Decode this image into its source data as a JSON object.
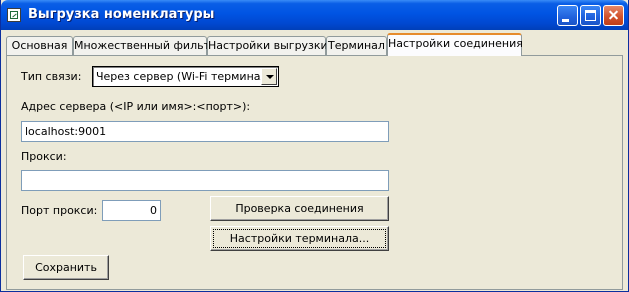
{
  "window": {
    "title": "Выгрузка номенклатуры"
  },
  "tabs": [
    {
      "label": "Основная"
    },
    {
      "label": "Множественный фильтр"
    },
    {
      "label": "Настройки выгрузки"
    },
    {
      "label": "Терминал"
    },
    {
      "label": "Настройки соединения",
      "active": true
    }
  ],
  "connection": {
    "type_label": "Тип связи:",
    "type_value": "Через сервер (Wi-Fi терминалы",
    "address_label": "Адрес сервера (<IP или имя>:<порт>):",
    "address_value": "localhost:9001",
    "proxy_label": "Прокси:",
    "proxy_value": "",
    "proxy_port_label": "Порт прокси:",
    "proxy_port_value": "0",
    "check_button": "Проверка соединения",
    "terminal_settings_button": "Настройки терминала...",
    "save_button": "Сохранить"
  }
}
